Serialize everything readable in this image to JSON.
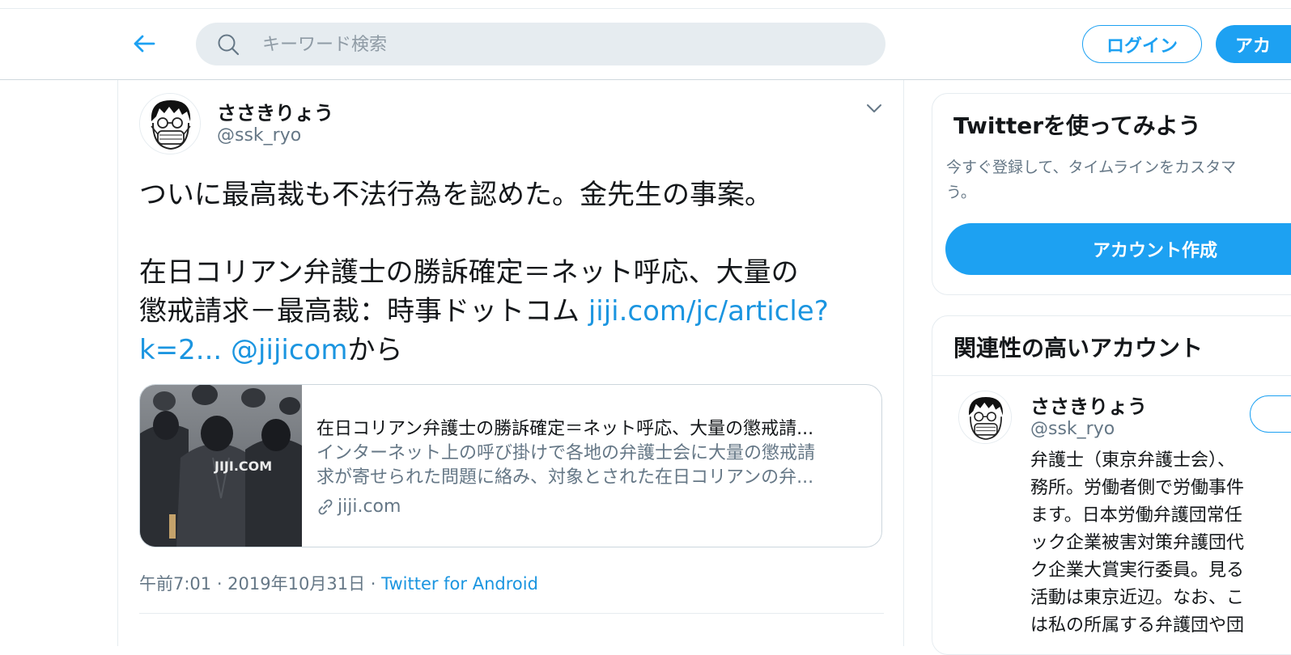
{
  "header": {
    "search": {
      "placeholder": "キーワード検索"
    },
    "login_label": "ログイン",
    "signup_label": "アカ"
  },
  "tweet": {
    "author_name": "ささきりょう",
    "author_handle": "@ssk_ryo",
    "text_line1": "ついに最高裁も不法行為を認めた。金先生の事案。",
    "text_line2": "在日コリアン弁護士の勝訴確定＝ネット呼応、大量の",
    "text_line3_plain": "懲戒請求－最高裁：時事ドットコム ",
    "text_line3_link": "jiji.com/jc/article?",
    "text_line4_link": "k=2...",
    "text_line4_mention": "@jijicom",
    "text_line4_suffix": "から",
    "card": {
      "image_watermark": "JIJI.COM",
      "title": "在日コリアン弁護士の勝訴確定＝ネット呼応、大量の懲戒請...",
      "description_line1": "インターネット上の呼び掛けで各地の弁護士会に大量の懲戒請",
      "description_line2": "求が寄せられた問題に絡み、対象とされた在日コリアンの弁...",
      "domain": "jiji.com"
    },
    "meta": {
      "time_date": "午前7:01 · 2019年10月31日 · ",
      "source": "Twitter for Android"
    }
  },
  "sidebar": {
    "signup_panel": {
      "title": "Twitterを使ってみよう",
      "subtitle_line1": "今すぐ登録して、タイムラインをカスタマ",
      "subtitle_line2": "う。",
      "cta_label": "アカウント作成"
    },
    "related_panel": {
      "title": "関連性の高いアカウント",
      "account": {
        "name": "ささきりょう",
        "handle": "@ssk_ryo",
        "bio_lines": [
          "弁護士（東京弁護士会）、",
          "務所。労働者側で労働事件",
          "ます。日本労働弁護団常任",
          "ック企業被害対策弁護団代",
          "ク企業大賞実行委員。見る",
          "活動は東京近辺。なお、こ",
          "は私の所属する弁護団や団"
        ]
      }
    }
  },
  "colors": {
    "accent": "#1da1f2",
    "link": "#1b95e0",
    "muted": "#657786",
    "border": "#e6ecf0"
  },
  "icons": [
    "back-arrow-icon",
    "search-icon",
    "chevron-down-icon",
    "link-icon"
  ]
}
